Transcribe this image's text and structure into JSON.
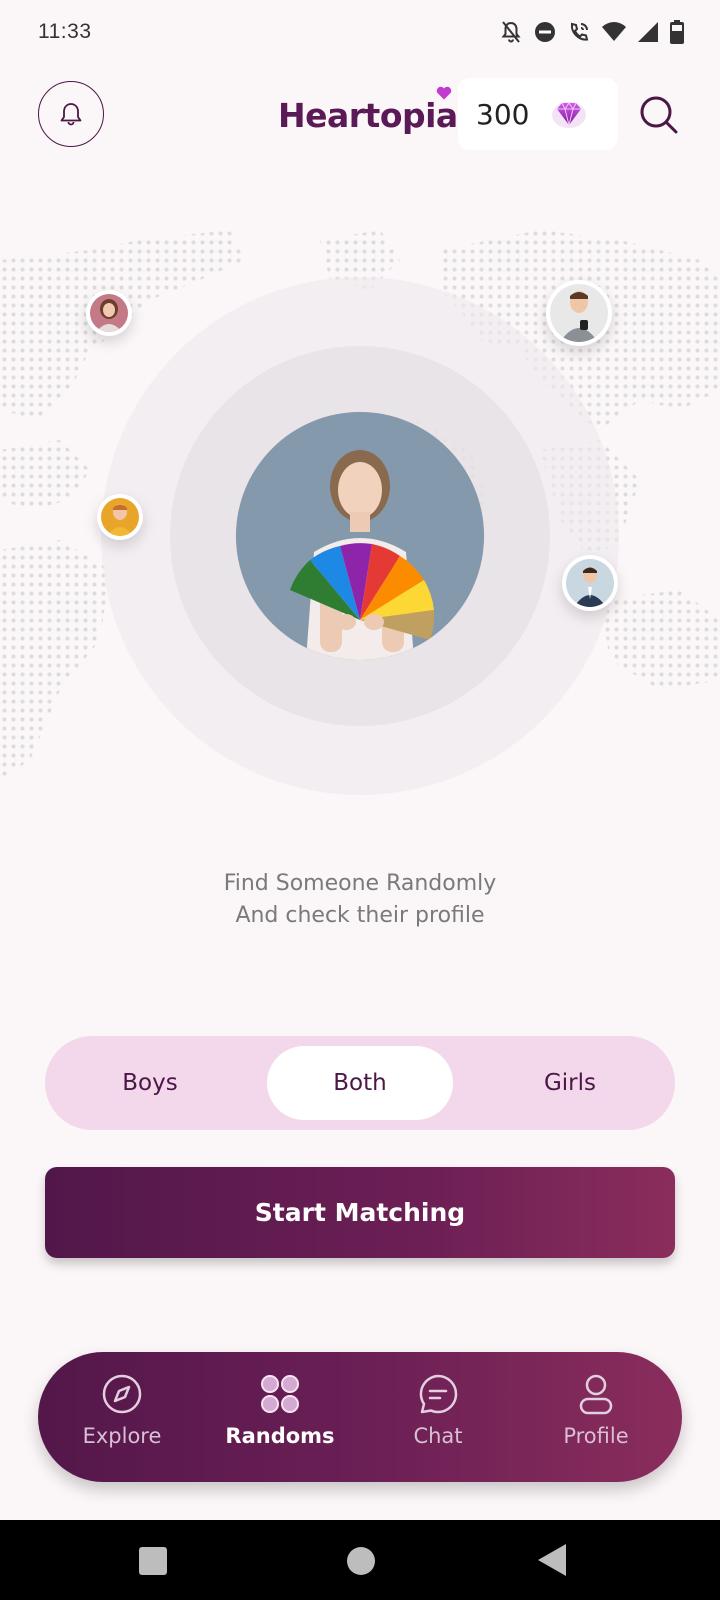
{
  "status_bar": {
    "time": "11:33",
    "icons": [
      "notifications-off-icon",
      "do-not-disturb-icon",
      "wifi-calling-icon",
      "wifi-icon",
      "signal-icon",
      "battery-icon"
    ]
  },
  "header": {
    "logo_text": "Heartopia",
    "gems": "300",
    "gem_icon": "gem-icon",
    "bell_icon": "bell-icon",
    "search_icon": "search-icon"
  },
  "tagline": {
    "line1": "Find Someone Randomly",
    "line2": "And check their profile"
  },
  "gender_filter": {
    "options": [
      "Boys",
      "Both",
      "Girls"
    ],
    "selected": "Both"
  },
  "start_button": "Start Matching",
  "bottom_nav": {
    "items": [
      {
        "label": "Explore",
        "icon": "compass-icon"
      },
      {
        "label": "Randoms",
        "icon": "grid-dots-icon"
      },
      {
        "label": "Chat",
        "icon": "chat-bubble-icon"
      },
      {
        "label": "Profile",
        "icon": "user-icon"
      }
    ],
    "active": "Randoms"
  },
  "colors": {
    "brand": "#5a1a57",
    "accent_gradient_start": "#52174a",
    "accent_gradient_end": "#8a2d5c",
    "segment_bg": "#f3d7ea",
    "gem": "#9c27b0",
    "background": "#fbf6f8"
  }
}
